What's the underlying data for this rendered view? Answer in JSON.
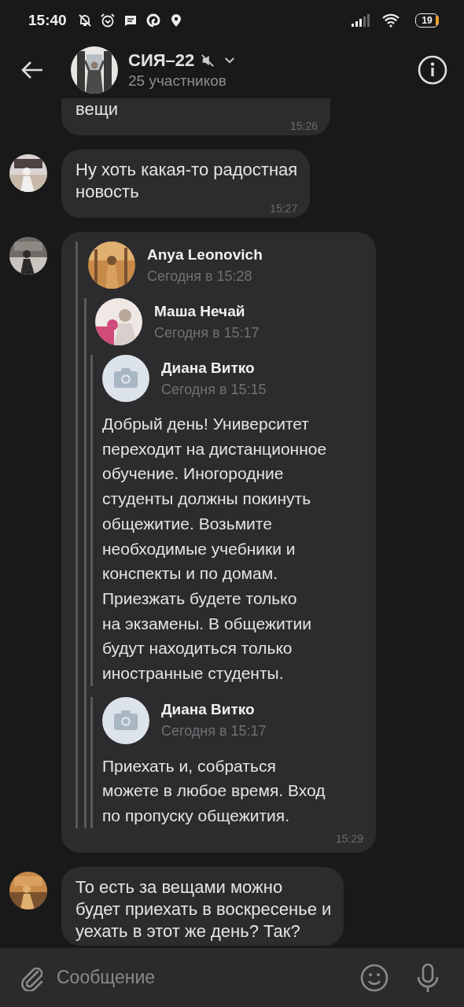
{
  "status_bar": {
    "time": "15:40",
    "battery": "19"
  },
  "header": {
    "title": "СИЯ–22",
    "muted": true,
    "subtitle": "25 участников",
    "avatar": {
      "kind": "picture"
    }
  },
  "messages": [
    {
      "kind": "text",
      "text": "вещи",
      "time": "15:26"
    },
    {
      "kind": "text",
      "avatar": {
        "kind": "picture"
      },
      "text": "Ну хоть какая-то радостная\nновость",
      "time": "15:27"
    },
    {
      "kind": "forward",
      "avatar": {
        "kind": "picture"
      },
      "time": "15:29",
      "forwards": [
        {
          "name": "Anya Leonovich",
          "time": "Сегодня в 15:28",
          "avatar": {
            "kind": "picture"
          },
          "children": [
            {
              "name": "Маша Нечай",
              "time": "Сегодня в 15:17",
              "avatar": {
                "kind": "picture"
              },
              "children": [
                {
                  "name": "Диана Витко",
                  "time": "Сегодня в 15:15",
                  "avatar": {
                    "kind": "placeholder"
                  },
                  "text": "Добрый день! Университет\nпереходит на дистанционное\nобучение. Иногородние\nстуденты должны покинуть\nобщежитие. Возьмите\nнеобходимые учебники и\nконспекты и по домам.\nПриезжать будете только\nна экзамены. В общежитии\nбудут находиться только\nиностранные студенты."
                },
                {
                  "name": "Диана Витко",
                  "time": "Сегодня в 15:17",
                  "avatar": {
                    "kind": "placeholder"
                  },
                  "text": "Приехать и, собраться\nможете в любое время. Вход\nпо пропуску общежития."
                }
              ]
            }
          ]
        }
      ]
    },
    {
      "kind": "text",
      "avatar": {
        "kind": "picture"
      },
      "text": "То есть за вещами можно\nбудет приехать в воскресенье и\nуехать в этот же день? Так?"
    }
  ],
  "composer": {
    "placeholder": "Сообщение"
  }
}
